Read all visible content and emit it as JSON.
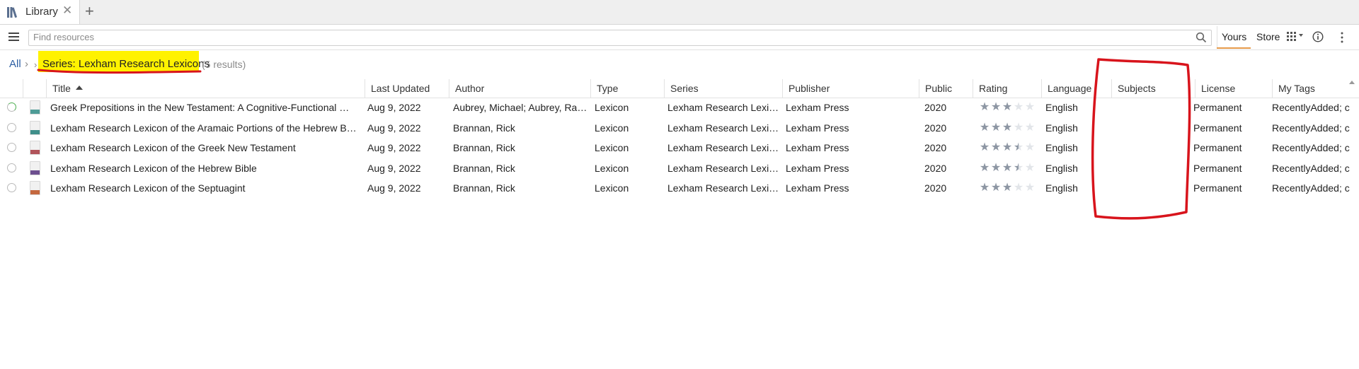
{
  "tab": {
    "label": "Library",
    "close": "✕",
    "new_tab": "+"
  },
  "toolbar": {
    "search_placeholder": "Find resources",
    "yours_label": "Yours",
    "store_label": "Store"
  },
  "breadcrumb": {
    "all": "All",
    "separator": "›",
    "series": "Series: Lexham Research Lexicons",
    "count": "(5 results)"
  },
  "columns": [
    "Title",
    "Last Updated",
    "Author",
    "Type",
    "Series",
    "Publisher",
    "Public",
    "Rating",
    "Language",
    "Subjects",
    "License",
    "My Tags"
  ],
  "rows": [
    {
      "title": "Greek Prepositions in the New Testament: A Cognitive-Functional …",
      "updated": "Aug 9, 2022",
      "author": "Aubrey, Michael; Aubrey, Ra…",
      "type": "Lexicon",
      "series": "Lexham Research Lexi…",
      "publisher": "Lexham Press",
      "public": "2020",
      "rating": 3,
      "language": "English",
      "subjects": "",
      "license": "Permanent",
      "tags": "RecentlyAdded; c",
      "cover_color": "#4e9c97",
      "status": "partial"
    },
    {
      "title": "Lexham Research Lexicon of the Aramaic Portions of the Hebrew B…",
      "updated": "Aug 9, 2022",
      "author": "Brannan, Rick",
      "type": "Lexicon",
      "series": "Lexham Research Lexi…",
      "publisher": "Lexham Press",
      "public": "2020",
      "rating": 3,
      "language": "English",
      "subjects": "",
      "license": "Permanent",
      "tags": "RecentlyAdded; c",
      "cover_color": "#3f8f8a",
      "status": "none"
    },
    {
      "title": "Lexham Research Lexicon of the Greek New Testament",
      "updated": "Aug 9, 2022",
      "author": "Brannan, Rick",
      "type": "Lexicon",
      "series": "Lexham Research Lexi…",
      "publisher": "Lexham Press",
      "public": "2020",
      "rating": 3.5,
      "language": "English",
      "subjects": "",
      "license": "Permanent",
      "tags": "RecentlyAdded; c",
      "cover_color": "#b1545a",
      "status": "none"
    },
    {
      "title": "Lexham Research Lexicon of the Hebrew Bible",
      "updated": "Aug 9, 2022",
      "author": "Brannan, Rick",
      "type": "Lexicon",
      "series": "Lexham Research Lexi…",
      "publisher": "Lexham Press",
      "public": "2020",
      "rating": 3.5,
      "language": "English",
      "subjects": "",
      "license": "Permanent",
      "tags": "RecentlyAdded; c",
      "cover_color": "#6d4f8f",
      "status": "none"
    },
    {
      "title": "Lexham Research Lexicon of the Septuagint",
      "updated": "Aug 9, 2022",
      "author": "Brannan, Rick",
      "type": "Lexicon",
      "series": "Lexham Research Lexi…",
      "publisher": "Lexham Press",
      "public": "2020",
      "rating": 3,
      "language": "English",
      "subjects": "",
      "license": "Permanent",
      "tags": "RecentlyAdded; c",
      "cover_color": "#c4683f",
      "status": "none"
    }
  ],
  "colors": {
    "highlight": "#fff200",
    "annotation": "#d8141c",
    "accent": "#e69a4a",
    "link": "#2d5fa3"
  },
  "icons": {
    "library": "library-icon",
    "menu": "hamburger-menu-icon",
    "search": "search-icon",
    "view": "view-options-icon",
    "info": "info-icon",
    "more": "more-vertical-icon"
  }
}
